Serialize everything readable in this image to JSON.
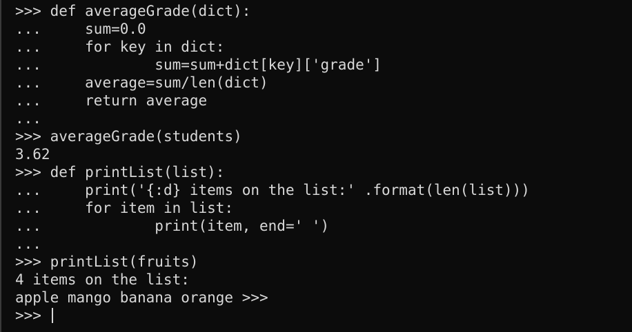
{
  "console": {
    "lines": [
      {
        "prompt": ">>> ",
        "code": "def averageGrade(dict):"
      },
      {
        "prompt": "...     ",
        "code": "sum=0.0"
      },
      {
        "prompt": "...     ",
        "code": "for key in dict:"
      },
      {
        "prompt": "...             ",
        "code": "sum=sum+dict[key]['grade']"
      },
      {
        "prompt": "...     ",
        "code": "average=sum/len(dict)"
      },
      {
        "prompt": "...     ",
        "code": "return average"
      },
      {
        "prompt": "...",
        "code": ""
      },
      {
        "prompt": ">>> ",
        "code": "averageGrade(students)"
      },
      {
        "prompt": "",
        "code": "3.62"
      },
      {
        "prompt": ">>> ",
        "code": "def printList(list):"
      },
      {
        "prompt": "...     ",
        "code": "print('{:d} items on the list:' .format(len(list)))"
      },
      {
        "prompt": "...     ",
        "code": "for item in list:"
      },
      {
        "prompt": "...             ",
        "code": "print(item, end=' ')"
      },
      {
        "prompt": "...",
        "code": ""
      },
      {
        "prompt": ">>> ",
        "code": "printList(fruits)"
      },
      {
        "prompt": "",
        "code": "4 items on the list:"
      },
      {
        "prompt": "",
        "code": "apple mango banana orange >>>"
      },
      {
        "prompt": ">>> ",
        "code": ""
      }
    ]
  }
}
